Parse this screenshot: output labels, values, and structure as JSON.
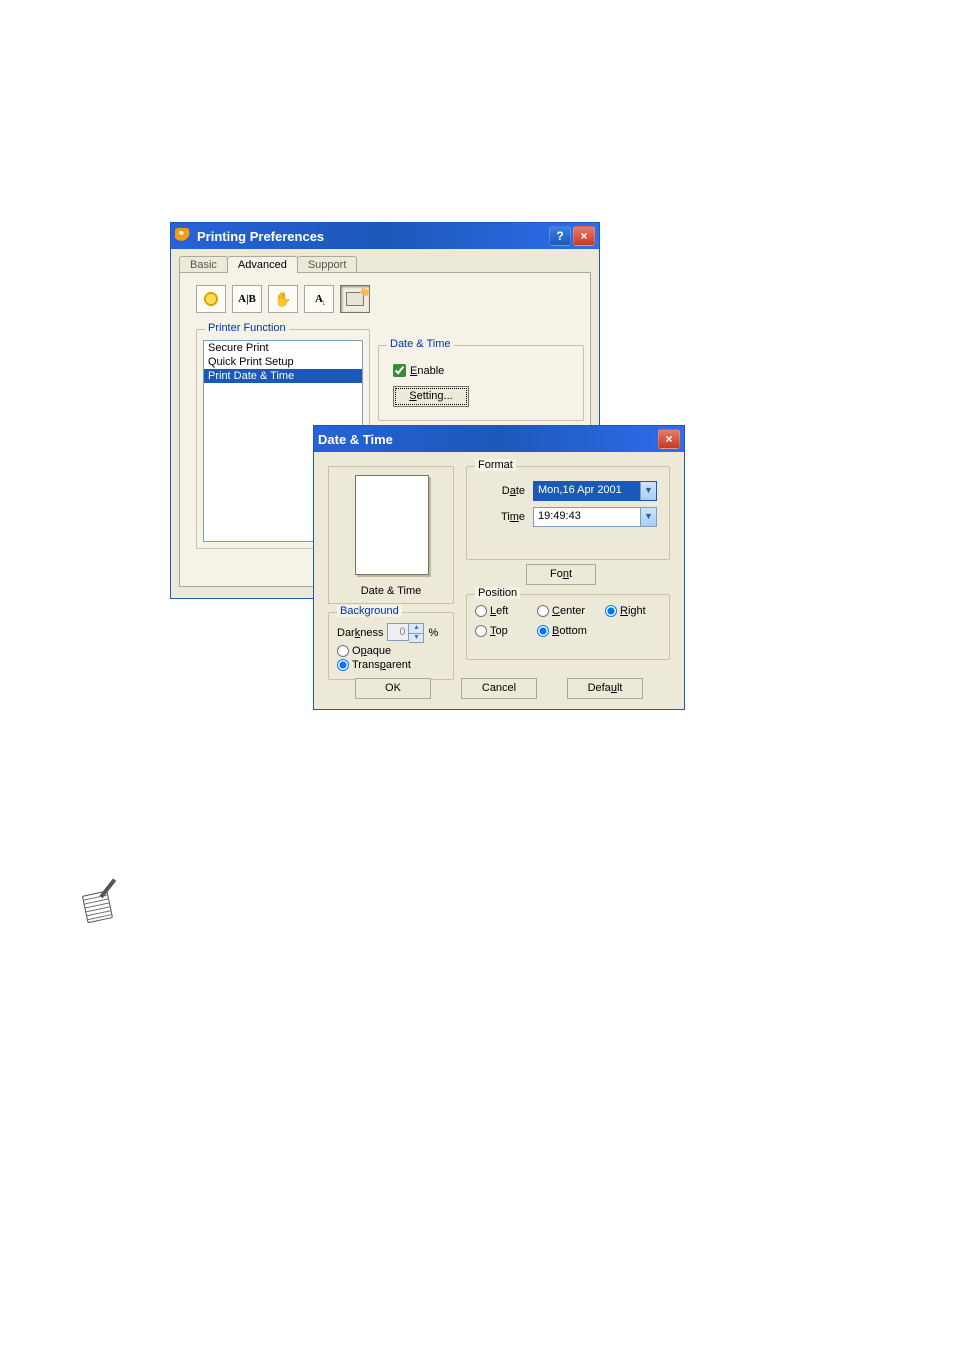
{
  "prefs": {
    "title": "Printing Preferences",
    "tabs": {
      "basic": "Basic",
      "advanced": "Advanced",
      "support": "Support"
    },
    "printer_function": {
      "group": "Printer Function",
      "items": [
        "Secure Print",
        "Quick Print Setup",
        "Print Date & Time"
      ]
    },
    "dt_group": {
      "title": "Date & Time",
      "enable": "Enable",
      "setting": "Setting..."
    },
    "toolbar_icons": {
      "sun": "print-quality-icon",
      "ab": "duplex-icon",
      "hand": "watermark-icon",
      "av": "page-setting-icon",
      "dev": "device-options-icon"
    }
  },
  "dt": {
    "title": "Date & Time",
    "preview_caption": "Date & Time",
    "format": {
      "group": "Format",
      "date_label": "Date",
      "date_value": "Mon,16 Apr 2001",
      "time_label": "Time",
      "time_value": "19:49:43",
      "font_btn": "Font"
    },
    "position": {
      "group": "Position",
      "left": "Left",
      "center": "Center",
      "right": "Right",
      "top": "Top",
      "bottom": "Bottom"
    },
    "background": {
      "group": "Background",
      "darkness": "Darkness",
      "darkness_value": "0",
      "pct": "%",
      "opaque": "Opaque",
      "transparent": "Transparent"
    },
    "buttons": {
      "ok": "OK",
      "cancel": "Cancel",
      "default": "Default"
    }
  }
}
